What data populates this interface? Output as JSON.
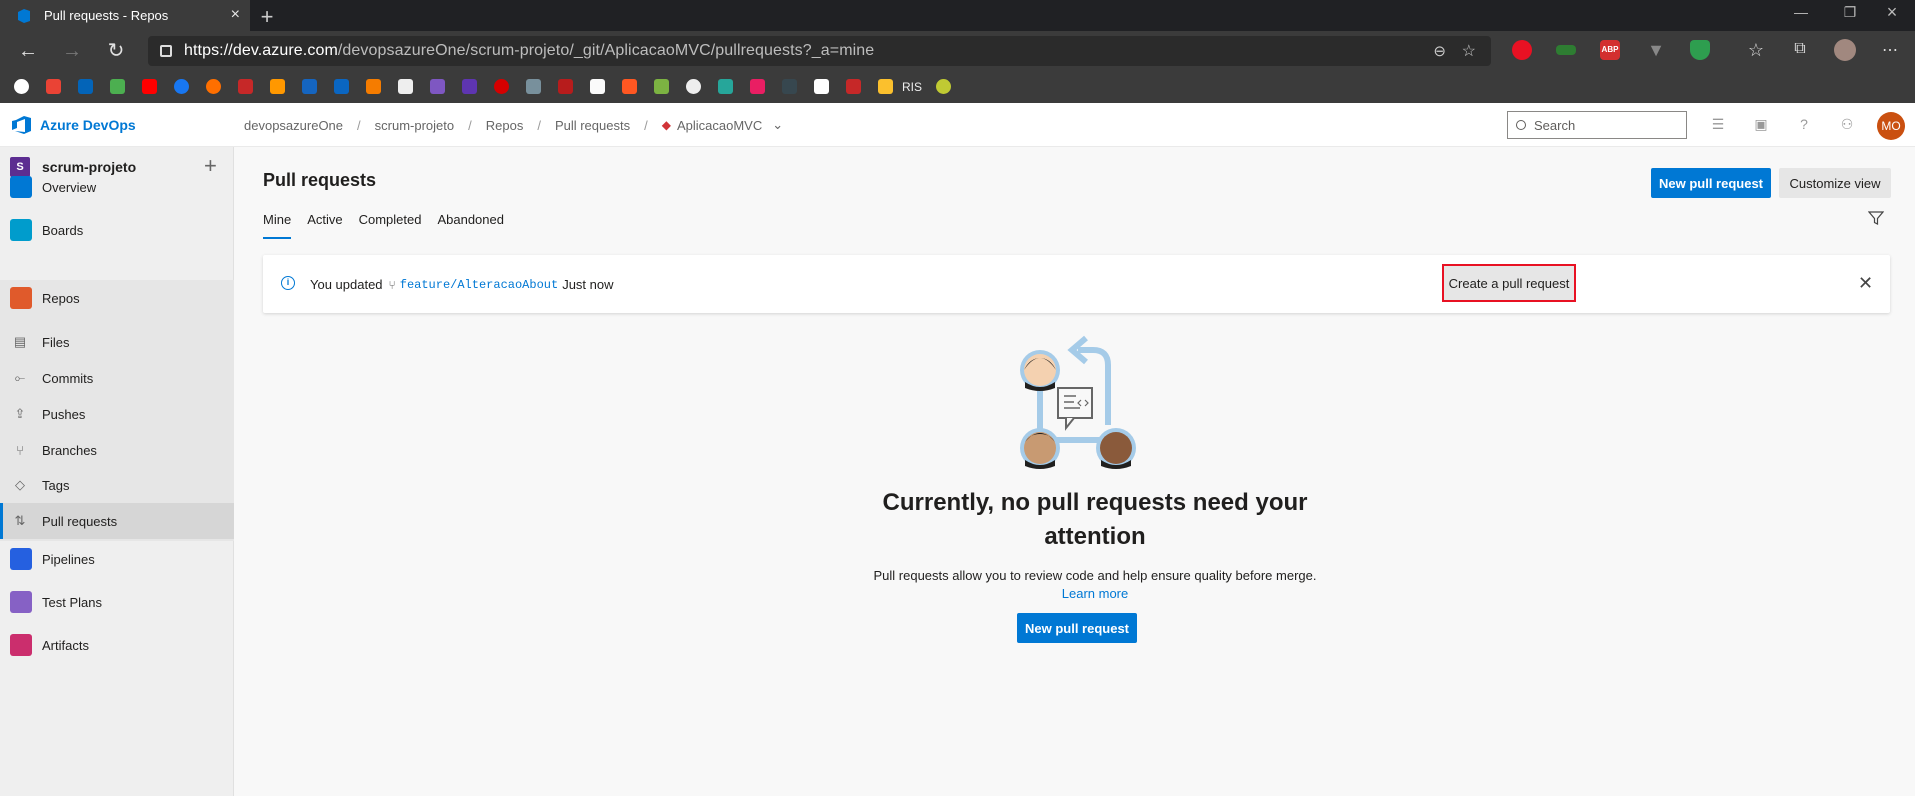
{
  "browser": {
    "tab_title": "Pull requests - Repos",
    "url_main": "https://dev.azure.com",
    "url_rest": "/devopsazureOne/scrum-projeto/_git/AplicacaoMVC/pullrequests?_a=mine",
    "bookmark_label": "RIS"
  },
  "header": {
    "brand": "Azure DevOps",
    "breadcrumbs": [
      "devopsazureOne",
      "scrum-projeto",
      "Repos",
      "Pull requests"
    ],
    "repo": "AplicacaoMVC",
    "search_placeholder": "Search",
    "avatar_initials": "MO"
  },
  "sidebar": {
    "project_badge": "S",
    "project_name": "scrum-projeto",
    "items": [
      {
        "label": "Overview",
        "color": "#0078d4"
      },
      {
        "label": "Boards",
        "color": "#009ccc"
      },
      {
        "label": "Repos",
        "color": "#e05a2b"
      },
      {
        "label": "Pipelines",
        "color": "#2560e0"
      },
      {
        "label": "Test Plans",
        "color": "#8661c5"
      },
      {
        "label": "Artifacts",
        "color": "#cb2e6d"
      }
    ],
    "repos_sub": [
      "Files",
      "Commits",
      "Pushes",
      "Branches",
      "Tags",
      "Pull requests"
    ]
  },
  "main": {
    "title": "Pull requests",
    "new_pr_label": "New pull request",
    "customize_label": "Customize view",
    "tabs": [
      "Mine",
      "Active",
      "Completed",
      "Abandoned"
    ],
    "banner": {
      "prefix": "You updated",
      "branch": "feature/AlteracaoAbout",
      "suffix": "Just now",
      "action": "Create a pull request"
    },
    "empty": {
      "title": "Currently, no pull requests need your attention",
      "desc": "Pull requests allow you to review code and help ensure quality before merge.",
      "link": "Learn more",
      "button": "New pull request"
    }
  }
}
